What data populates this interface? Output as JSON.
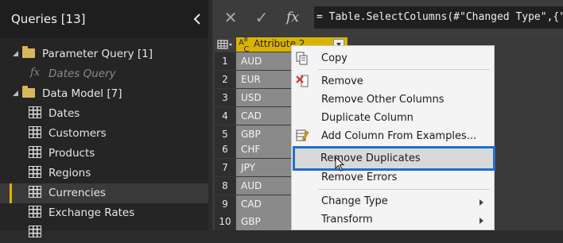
{
  "queries_pane": {
    "title": "Queries [13]",
    "items": [
      {
        "label": "Parameter Query [1]",
        "kind": "group"
      },
      {
        "label": "Dates Query",
        "kind": "function"
      },
      {
        "label": "Data Model [7]",
        "kind": "group"
      },
      {
        "label": "Dates",
        "kind": "table"
      },
      {
        "label": "Customers",
        "kind": "table"
      },
      {
        "label": "Products",
        "kind": "table"
      },
      {
        "label": "Regions",
        "kind": "table"
      },
      {
        "label": "Currencies",
        "kind": "table",
        "selected": true
      },
      {
        "label": "Exchange Rates",
        "kind": "table"
      }
    ]
  },
  "formula_bar": {
    "cancel_icon": "✕",
    "commit_icon": "✓",
    "fx_icon": "fx",
    "formula": "= Table.SelectColumns(#\"Changed Type\",{\"Attri"
  },
  "grid": {
    "column_header": "Attribute.2",
    "column_type_icon": "ABC",
    "rows": [
      {
        "num": "1",
        "value": "AUD"
      },
      {
        "num": "2",
        "value": "EUR"
      },
      {
        "num": "3",
        "value": "USD"
      },
      {
        "num": "4",
        "value": "CAD"
      },
      {
        "num": "5",
        "value": "GBP"
      },
      {
        "num": "6",
        "value": "CHF"
      },
      {
        "num": "7",
        "value": "JPY"
      },
      {
        "num": "8",
        "value": "AUD"
      },
      {
        "num": "9",
        "value": "CAD"
      },
      {
        "num": "10",
        "value": "GBP"
      }
    ]
  },
  "context_menu": {
    "copy": "Copy",
    "remove": "Remove",
    "remove_other_columns": "Remove Other Columns",
    "duplicate_column": "Duplicate Column",
    "add_column_from_examples": "Add Column From Examples...",
    "remove_duplicates": "Remove Duplicates",
    "remove_errors": "Remove Errors",
    "change_type": "Change Type",
    "transform": "Transform"
  },
  "colors": {
    "highlight_border": "#1f6fcf",
    "column_header": "#d8b400",
    "selected_accent": "#e0b000"
  }
}
